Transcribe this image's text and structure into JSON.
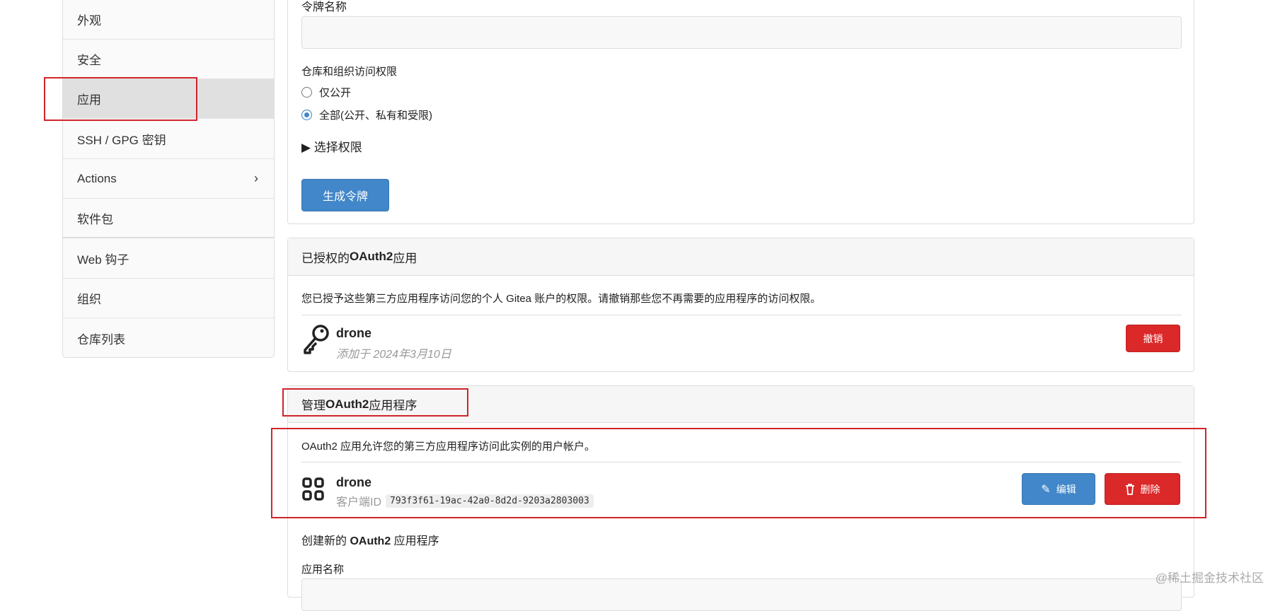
{
  "sidebar": {
    "items": [
      {
        "label": "外观"
      },
      {
        "label": "安全"
      },
      {
        "label": "应用"
      },
      {
        "label": "SSH / GPG 密钥"
      },
      {
        "label": "Actions"
      },
      {
        "label": "软件包"
      },
      {
        "label": "Web 钩子"
      },
      {
        "label": "组织"
      },
      {
        "label": "仓库列表"
      }
    ]
  },
  "token": {
    "name_label": "令牌名称",
    "name_value": "",
    "access_label": "仓库和组织访问权限",
    "radio_public": "仅公开",
    "radio_all": "全部(公开、私有和受限)",
    "select_perms": "▶ 选择权限",
    "generate": "生成令牌"
  },
  "authorized": {
    "title_pre": "已授权的 ",
    "title_bold": "OAuth2",
    "title_post": " 应用",
    "desc": "您已授予这些第三方应用程序访问您的个人 Gitea 账户的权限。请撤销那些您不再需要的应用程序的访问权限。",
    "app_name": "drone",
    "added": "添加于 2024年3月10日",
    "revoke": "撤销"
  },
  "manage": {
    "title_pre": "管理 ",
    "title_bold": "OAuth2",
    "title_post": " 应用程序",
    "desc": "OAuth2 应用允许您的第三方应用程序访问此实例的用户帐户。",
    "app_name": "drone",
    "client_id_label": "客户端ID",
    "client_id": "793f3f61-19ac-42a0-8d2d-9203a2803003",
    "edit": "编辑",
    "delete": "删除",
    "create_pre": "创建新的 ",
    "create_bold": "OAuth2",
    "create_post": " 应用程序",
    "app_name_label": "应用名称",
    "app_name_value": ""
  },
  "watermark": "@稀土掘金技术社区"
}
